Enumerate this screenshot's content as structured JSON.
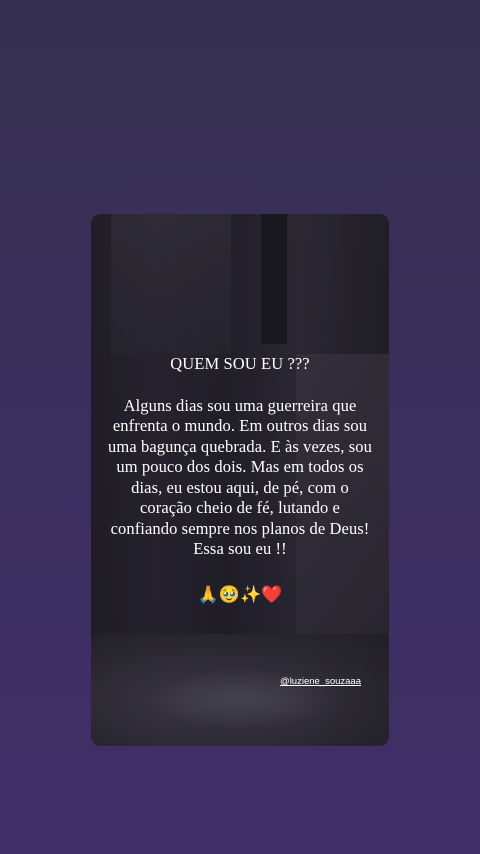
{
  "story": {
    "title": "QUEM SOU EU ???",
    "body": "Alguns dias sou uma guerreira que enfrenta o mundo. Em outros dias sou uma bagunça quebrada. E às vezes, sou um pouco dos dois. Mas em todos os dias, eu estou aqui, de pé, com o coração cheio de fé, lutando e confiando sempre nos planos de Deus! Essa sou eu !!",
    "emojis": {
      "pray": "🙏",
      "face": "🥹",
      "sparkles": "✨",
      "heart": "❤️"
    },
    "mention": "@luziene_souzaaa"
  },
  "colors": {
    "background_top": "#35304f",
    "background_bottom": "#3f2f68",
    "text": "#ffffff"
  }
}
